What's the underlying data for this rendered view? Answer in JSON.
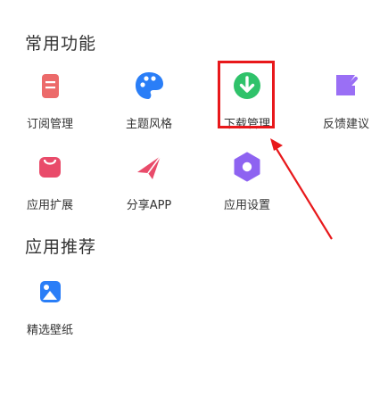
{
  "sections": {
    "common": "常用功能",
    "recommend": "应用推荐"
  },
  "items": [
    {
      "label": "订阅管理",
      "icon": "subscription-icon",
      "color": "#ec6a6a"
    },
    {
      "label": "主题风格",
      "icon": "palette-icon",
      "color": "#2a7ef7"
    },
    {
      "label": "下载管理",
      "icon": "download-icon",
      "color": "#2fc26a"
    },
    {
      "label": "反馈建议",
      "icon": "feedback-icon",
      "color": "#9a6ff5"
    },
    {
      "label": "应用扩展",
      "icon": "extension-icon",
      "color": "#e94b6a"
    },
    {
      "label": "分享APP",
      "icon": "share-icon",
      "color": "#e94b6a"
    },
    {
      "label": "应用设置",
      "icon": "settings-icon",
      "color": "#8e63f1"
    },
    {
      "label": "精选壁纸",
      "icon": "wallpaper-icon",
      "color": "#2a7ef7"
    }
  ],
  "colors": {
    "highlight": "#e8181b"
  }
}
